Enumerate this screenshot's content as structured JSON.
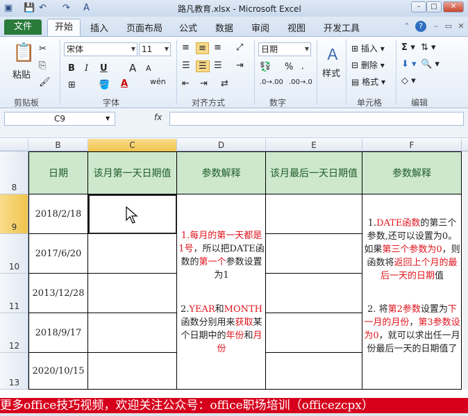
{
  "window": {
    "title": "路凡教育.xlsx - Microsoft Excel",
    "minimize": "–",
    "restore": "□",
    "close": "✕"
  },
  "tabs": {
    "file": "文件",
    "items": [
      "开始",
      "插入",
      "页面布局",
      "公式",
      "数据",
      "审阅",
      "视图",
      "开发工具"
    ]
  },
  "ribbon": {
    "clipboard": {
      "label": "剪贴板",
      "paste": "粘贴"
    },
    "font": {
      "label": "字体",
      "name": "宋体",
      "size": "11",
      "bold": "B",
      "italic": "I",
      "underline": "U",
      "grow": "A",
      "shrink": "A",
      "wen": "wén"
    },
    "alignment": {
      "label": "对齐方式"
    },
    "number": {
      "label": "数字",
      "format": "日期",
      "percent": "%"
    },
    "styles": {
      "label": "样式"
    },
    "cells": {
      "label": "单元格",
      "insert": "插入",
      "delete": "删除",
      "format": "格式"
    },
    "editing": {
      "label": "编辑"
    }
  },
  "formula_bar": {
    "name_box": "C9",
    "fx": "fx",
    "value": ""
  },
  "grid": {
    "columns": [
      "B",
      "C",
      "D",
      "E",
      "F"
    ],
    "selected_column": "C",
    "rows": [
      "8",
      "9",
      "10",
      "11",
      "12",
      "13"
    ],
    "selected_row": "9",
    "headers": [
      "日期",
      "该月第一天日期值",
      "参数解释",
      "该月最后一天日期值",
      "参数解释"
    ],
    "dates": [
      "2018/2/18",
      "2017/6/20",
      "2013/12/28",
      "2018/9/17",
      "2020/10/15"
    ],
    "note_d": {
      "p1_a": "1.",
      "p1_b": "每月的第一天都是1号",
      "p1_c": "，所以把DATE函数的",
      "p1_d": "第一个",
      "p1_e": "参数设置为1",
      "p2_a": "2.",
      "p2_b": "YEAR",
      "p2_c": "和",
      "p2_d": "MONTH",
      "p2_e": "函数分别用来",
      "p2_f": "获取",
      "p2_g": "某个日期中的",
      "p2_h": "年份",
      "p2_i": "和",
      "p2_j": "月份"
    },
    "note_f": {
      "p1_a": "1.",
      "p1_b": "DATE函数",
      "p1_c": "的第三个参数,还可以设置为0。如果",
      "p1_d": "第三个参数为0",
      "p1_e": "，则函数将",
      "p1_f": "返回上个月的最后一天的日期",
      "p1_g": "值",
      "p2_a": "2. 将",
      "p2_b": "第2参数",
      "p2_c": "设置为",
      "p2_d": "下一月的月份",
      "p2_e": "，",
      "p2_f": "第3参数设为0",
      "p2_g": "，就可以求出任一月份最后一天的日期值了"
    }
  },
  "banner": {
    "text": "更多office技巧视频，欢迎关注公众号：office职场培训（officezcpx）"
  },
  "colors": {
    "header_fill": "#cde8cc",
    "accent_red": "#e0141e",
    "banner": "#d6001c",
    "file_tab": "#2a7a3a"
  }
}
